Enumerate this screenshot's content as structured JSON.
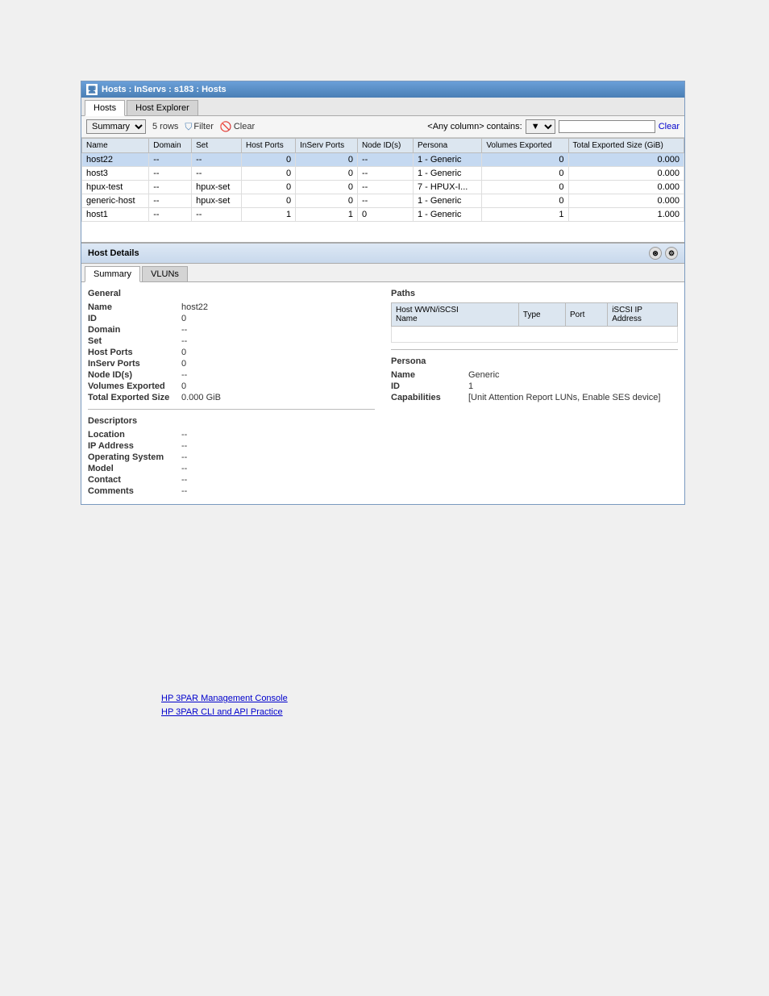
{
  "window": {
    "title": "Hosts : InServs : s183 : Hosts",
    "icon": "🖥"
  },
  "tabs": {
    "main": [
      {
        "id": "hosts",
        "label": "Hosts",
        "active": true
      },
      {
        "id": "host-explorer",
        "label": "Host Explorer",
        "active": false
      }
    ],
    "details": [
      {
        "id": "summary",
        "label": "Summary",
        "active": true
      },
      {
        "id": "vluns",
        "label": "VLUNs",
        "active": false
      }
    ]
  },
  "toolbar": {
    "view_label": "Summary",
    "row_count": "5 rows",
    "filter_label": "Filter",
    "clear_label": "Clear",
    "search_label": "<Any column> contains:",
    "search_placeholder": "",
    "clear_search_label": "Clear"
  },
  "table": {
    "columns": [
      {
        "id": "name",
        "label": "Name"
      },
      {
        "id": "domain",
        "label": "Domain"
      },
      {
        "id": "set",
        "label": "Set"
      },
      {
        "id": "host_ports",
        "label": "Host Ports"
      },
      {
        "id": "inserv_ports",
        "label": "InServ Ports"
      },
      {
        "id": "node_id",
        "label": "Node ID(s)"
      },
      {
        "id": "persona",
        "label": "Persona"
      },
      {
        "id": "volumes_exported",
        "label": "Volumes Exported"
      },
      {
        "id": "total_exported_size",
        "label": "Total Exported Size (GiB)"
      }
    ],
    "rows": [
      {
        "name": "host22",
        "domain": "--",
        "set": "--",
        "host_ports": "0",
        "inserv_ports": "0",
        "node_id": "--",
        "persona": "1 - Generic",
        "volumes_exported": "0",
        "total_exported_size": "0.000",
        "selected": true
      },
      {
        "name": "host3",
        "domain": "--",
        "set": "--",
        "host_ports": "0",
        "inserv_ports": "0",
        "node_id": "--",
        "persona": "1 - Generic",
        "volumes_exported": "0",
        "total_exported_size": "0.000",
        "selected": false
      },
      {
        "name": "hpux-test",
        "domain": "--",
        "set": "hpux-set",
        "host_ports": "0",
        "inserv_ports": "0",
        "node_id": "--",
        "persona": "7 - HPUX-I...",
        "volumes_exported": "0",
        "total_exported_size": "0.000",
        "selected": false
      },
      {
        "name": "generic-host",
        "domain": "--",
        "set": "hpux-set",
        "host_ports": "0",
        "inserv_ports": "0",
        "node_id": "--",
        "persona": "1 - Generic",
        "volumes_exported": "0",
        "total_exported_size": "0.000",
        "selected": false
      },
      {
        "name": "host1",
        "domain": "--",
        "set": "--",
        "host_ports": "1",
        "inserv_ports": "1",
        "node_id": "0",
        "persona": "1 - Generic",
        "volumes_exported": "1",
        "total_exported_size": "1.000",
        "selected": false
      }
    ]
  },
  "host_details": {
    "section_title": "Host Details",
    "general": {
      "title": "General",
      "fields": [
        {
          "label": "Name",
          "value": "host22"
        },
        {
          "label": "ID",
          "value": "0"
        },
        {
          "label": "Domain",
          "value": "--"
        },
        {
          "label": "Set",
          "value": "--"
        },
        {
          "label": "Host Ports",
          "value": "0"
        },
        {
          "label": "InServ Ports",
          "value": "0"
        },
        {
          "label": "Node ID(s)",
          "value": "--"
        },
        {
          "label": "Volumes Exported",
          "value": "0"
        },
        {
          "label": "Total Exported Size",
          "value": "0.000 GiB"
        }
      ]
    },
    "descriptors": {
      "title": "Descriptors",
      "fields": [
        {
          "label": "Location",
          "value": "--"
        },
        {
          "label": "IP Address",
          "value": "--"
        },
        {
          "label": "Operating System",
          "value": "--"
        },
        {
          "label": "Model",
          "value": "--"
        },
        {
          "label": "Contact",
          "value": "--"
        },
        {
          "label": "Comments",
          "value": "--"
        }
      ]
    },
    "paths": {
      "title": "Paths",
      "columns": [
        {
          "label": "Host WWN/iSCSI Name"
        },
        {
          "label": "Type"
        },
        {
          "label": "Port"
        },
        {
          "label": "iSCSI IP Address"
        }
      ],
      "rows": []
    },
    "persona": {
      "title": "Persona",
      "fields": [
        {
          "label": "Name",
          "value": "Generic"
        },
        {
          "label": "ID",
          "value": "1"
        },
        {
          "label": "Capabilities",
          "value": "[Unit Attention Report LUNs, Enable SES device]"
        }
      ]
    }
  },
  "footer": {
    "links": [
      {
        "label": "HP 3PAR Management Console",
        "url": "#"
      },
      {
        "label": "HP 3PAR CLI and API Practice",
        "url": "#"
      }
    ]
  }
}
